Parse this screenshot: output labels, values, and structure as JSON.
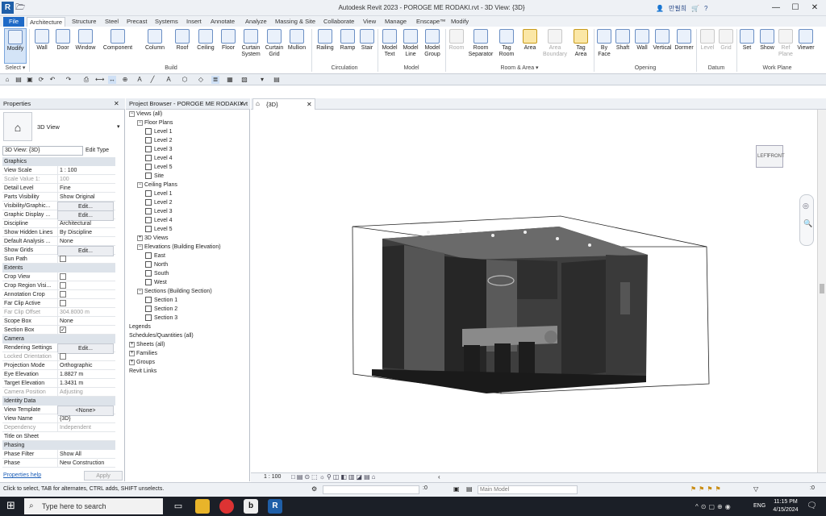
{
  "window": {
    "app_logo": "R",
    "title": "Autodesk Revit 2023 - POROGE ME RODAKI.rvt - 3D View: {3D}",
    "user": "만필희",
    "help": "?",
    "minimize": "—",
    "maximize": "☐",
    "close": "✕"
  },
  "tabs": [
    "File",
    "Architecture",
    "Structure",
    "Steel",
    "Precast",
    "Systems",
    "Insert",
    "Annotate",
    "Analyze",
    "Massing & Site",
    "Collaborate",
    "View",
    "Manage",
    "Enscape™",
    "Modify"
  ],
  "ribbon": {
    "buttons": [
      {
        "id": "modify",
        "label": "Modify"
      },
      {
        "id": "wall",
        "label": "Wall"
      },
      {
        "id": "door",
        "label": "Door"
      },
      {
        "id": "window",
        "label": "Window"
      },
      {
        "id": "component",
        "label": "Component"
      },
      {
        "id": "column",
        "label": "Column"
      },
      {
        "id": "roof",
        "label": "Roof"
      },
      {
        "id": "ceiling",
        "label": "Ceiling"
      },
      {
        "id": "floor",
        "label": "Floor"
      },
      {
        "id": "curtain-system",
        "label": "Curtain System"
      },
      {
        "id": "curtain-grid",
        "label": "Curtain Grid"
      },
      {
        "id": "mullion",
        "label": "Mullion"
      },
      {
        "id": "railing",
        "label": "Railing"
      },
      {
        "id": "ramp",
        "label": "Ramp"
      },
      {
        "id": "stair",
        "label": "Stair"
      },
      {
        "id": "model-text",
        "label": "Model Text"
      },
      {
        "id": "model-line",
        "label": "Model Line"
      },
      {
        "id": "model-group",
        "label": "Model Group"
      },
      {
        "id": "room",
        "label": "Room"
      },
      {
        "id": "room-separator",
        "label": "Room Separator"
      },
      {
        "id": "tag-room",
        "label": "Tag Room"
      },
      {
        "id": "area",
        "label": "Area"
      },
      {
        "id": "area-boundary",
        "label": "Area Boundary"
      },
      {
        "id": "tag-area",
        "label": "Tag Area"
      },
      {
        "id": "by-face",
        "label": "By Face"
      },
      {
        "id": "shaft",
        "label": "Shaft"
      },
      {
        "id": "wall-opening",
        "label": "Wall"
      },
      {
        "id": "vertical",
        "label": "Vertical"
      },
      {
        "id": "dormer",
        "label": "Dormer"
      },
      {
        "id": "level",
        "label": "Level"
      },
      {
        "id": "grid",
        "label": "Grid"
      },
      {
        "id": "set",
        "label": "Set"
      },
      {
        "id": "show",
        "label": "Show"
      },
      {
        "id": "ref-plane",
        "label": "Ref Plane"
      },
      {
        "id": "viewer",
        "label": "Viewer"
      }
    ],
    "panels": [
      "Select ▾",
      "Build",
      "Circulation",
      "Model",
      "Room & Area ▾",
      "Opening",
      "Datum",
      "Work Plane"
    ]
  },
  "properties": {
    "title": "Properties",
    "type_name": "3D View",
    "selector": "3D View: {3D}",
    "edit_type": "Edit Type",
    "sections": [
      {
        "name": "Graphics",
        "rows": [
          [
            "View Scale",
            "1 : 100"
          ],
          [
            "Scale Value 1:",
            "100"
          ],
          [
            "Detail Level",
            "Fine"
          ],
          [
            "Parts Visibility",
            "Show Original"
          ],
          [
            "Visibility/Graphic...",
            "Edit..."
          ],
          [
            "Graphic Display ...",
            "Edit..."
          ],
          [
            "Discipline",
            "Architectural"
          ],
          [
            "Show Hidden Lines",
            "By Discipline"
          ],
          [
            "Default Analysis ...",
            "None"
          ],
          [
            "Show Grids",
            "Edit..."
          ],
          [
            "Sun Path",
            ""
          ]
        ]
      },
      {
        "name": "Extents",
        "rows": [
          [
            "Crop View",
            ""
          ],
          [
            "Crop Region Visi...",
            ""
          ],
          [
            "Annotation Crop",
            ""
          ],
          [
            "Far Clip Active",
            ""
          ],
          [
            "Far Clip Offset",
            "304.8000 m"
          ],
          [
            "Scope Box",
            "None"
          ],
          [
            "Section Box",
            "✓"
          ]
        ]
      },
      {
        "name": "Camera",
        "rows": [
          [
            "Rendering Settings",
            "Edit..."
          ],
          [
            "Locked Orientation",
            ""
          ],
          [
            "Projection Mode",
            "Orthographic"
          ],
          [
            "Eye Elevation",
            "1.8827 m"
          ],
          [
            "Target Elevation",
            "1.3431 m"
          ],
          [
            "Camera Position",
            "Adjusting"
          ]
        ]
      },
      {
        "name": "Identity Data",
        "rows": [
          [
            "View Template",
            "<None>"
          ],
          [
            "View Name",
            "{3D}"
          ],
          [
            "Dependency",
            "Independent"
          ],
          [
            "Title on Sheet",
            ""
          ]
        ]
      },
      {
        "name": "Phasing",
        "rows": [
          [
            "Phase Filter",
            "Show All"
          ],
          [
            "Phase",
            "New Construction"
          ]
        ]
      }
    ],
    "help": "Properties help",
    "apply": "Apply"
  },
  "browser": {
    "title": "Project Browser - POROGE ME RODAKI.rvt",
    "nodes": [
      {
        "d": 0,
        "t": "Views (all)",
        "tw": "−"
      },
      {
        "d": 1,
        "t": "Floor Plans",
        "tw": "−"
      },
      {
        "d": 2,
        "t": "Level 1",
        "pg": true
      },
      {
        "d": 2,
        "t": "Level 2",
        "pg": true
      },
      {
        "d": 2,
        "t": "Level 3",
        "pg": true
      },
      {
        "d": 2,
        "t": "Level 4",
        "pg": true
      },
      {
        "d": 2,
        "t": "Level 5",
        "pg": true
      },
      {
        "d": 2,
        "t": "Site",
        "pg": true
      },
      {
        "d": 1,
        "t": "Ceiling Plans",
        "tw": "−"
      },
      {
        "d": 2,
        "t": "Level 1",
        "pg": true
      },
      {
        "d": 2,
        "t": "Level 2",
        "pg": true
      },
      {
        "d": 2,
        "t": "Level 3",
        "pg": true
      },
      {
        "d": 2,
        "t": "Level 4",
        "pg": true
      },
      {
        "d": 2,
        "t": "Level 5",
        "pg": true
      },
      {
        "d": 1,
        "t": "3D Views",
        "tw": "+"
      },
      {
        "d": 1,
        "t": "Elevations (Building Elevation)",
        "tw": "−"
      },
      {
        "d": 2,
        "t": "East",
        "pg": true
      },
      {
        "d": 2,
        "t": "North",
        "pg": true
      },
      {
        "d": 2,
        "t": "South",
        "pg": true
      },
      {
        "d": 2,
        "t": "West",
        "pg": true
      },
      {
        "d": 1,
        "t": "Sections (Building Section)",
        "tw": "−"
      },
      {
        "d": 2,
        "t": "Section 1",
        "pg": true
      },
      {
        "d": 2,
        "t": "Section 2",
        "pg": true
      },
      {
        "d": 2,
        "t": "Section 3",
        "pg": true
      },
      {
        "d": 0,
        "t": "Legends"
      },
      {
        "d": 0,
        "t": "Schedules/Quantities (all)"
      },
      {
        "d": 0,
        "t": "Sheets (all)",
        "tw": "+"
      },
      {
        "d": 0,
        "t": "Families",
        "tw": "+"
      },
      {
        "d": 0,
        "t": "Groups",
        "tw": "+"
      },
      {
        "d": 0,
        "t": "Revit Links"
      }
    ]
  },
  "view_tab": {
    "label": "{3D}",
    "close": "✕"
  },
  "viewcube": {
    "left": "LEFT",
    "front": "FRONT"
  },
  "view_control": {
    "scale": "1 : 100"
  },
  "status": {
    "message": "Click to select, TAB for alternates, CTRL adds, SHIFT unselects.",
    "worksets": ":0",
    "model": "Main Model",
    "filter": ":0"
  },
  "taskbar": {
    "search": "Type here to search",
    "lang": "ENG",
    "time": "11:15 PM",
    "date": "4/15/2024"
  }
}
